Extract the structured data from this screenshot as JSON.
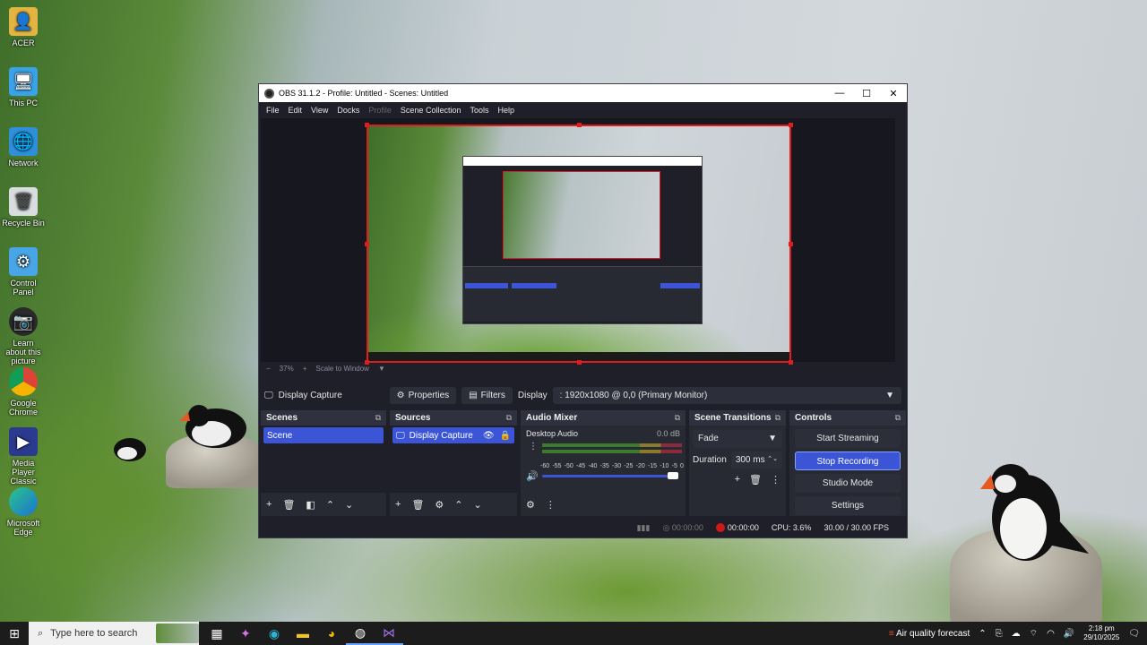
{
  "desktop_icons": [
    {
      "label": "ACER",
      "icon": "user-folder-icon"
    },
    {
      "label": "This PC",
      "icon": "computer-icon"
    },
    {
      "label": "Network",
      "icon": "network-icon"
    },
    {
      "label": "Recycle Bin",
      "icon": "recycle-bin-icon"
    },
    {
      "label": "Control Panel",
      "icon": "control-panel-icon"
    },
    {
      "label": "Learn about this picture",
      "icon": "camera-icon"
    },
    {
      "label": "Google Chrome",
      "icon": "chrome-icon"
    },
    {
      "label": "Media Player Classic",
      "icon": "media-player-icon"
    },
    {
      "label": "Microsoft Edge",
      "icon": "edge-icon"
    }
  ],
  "window": {
    "title": "OBS 31.1.2 - Profile: Untitled - Scenes: Untitled",
    "menu": [
      "File",
      "Edit",
      "View",
      "Docks",
      "Profile",
      "Scene Collection",
      "Tools",
      "Help"
    ]
  },
  "zoom": {
    "minus": "−",
    "level": "37%",
    "plus": "+",
    "mode": "Scale to Window"
  },
  "source_bar": {
    "source_name": "Display Capture",
    "properties_label": "Properties",
    "filters_label": "Filters",
    "display_label": "Display",
    "display_value": ": 1920x1080 @ 0,0 (Primary Monitor)"
  },
  "scenes": {
    "title": "Scenes",
    "items": [
      "Scene"
    ]
  },
  "sources": {
    "title": "Sources",
    "items": [
      "Display Capture"
    ]
  },
  "mixer": {
    "title": "Audio Mixer",
    "track": "Desktop Audio",
    "level": "0.0 dB",
    "ticks": [
      "-60",
      "-55",
      "-50",
      "-45",
      "-40",
      "-35",
      "-30",
      "-25",
      "-20",
      "-15",
      "-10",
      "-5",
      "0"
    ],
    "volume": 1.0
  },
  "transitions": {
    "title": "Scene Transitions",
    "type": "Fade",
    "duration_label": "Duration",
    "duration_value": "300 ms"
  },
  "controls": {
    "title": "Controls",
    "buttons": [
      "Start Streaming",
      "Stop Recording",
      "Studio Mode",
      "Settings"
    ]
  },
  "status": {
    "stream_time": "00:00:00",
    "rec_time": "00:00:00",
    "cpu": "CPU: 3.6%",
    "fps": "30.00 / 30.00 FPS"
  },
  "taskbar": {
    "search_placeholder": "Type here to search",
    "weather": "Air quality forecast",
    "time": "2:18 pm",
    "date": "29/10/2025"
  },
  "colors": {
    "accent": "#3b55d6",
    "record": "#d01818",
    "selection_border": "#e01c1c"
  }
}
